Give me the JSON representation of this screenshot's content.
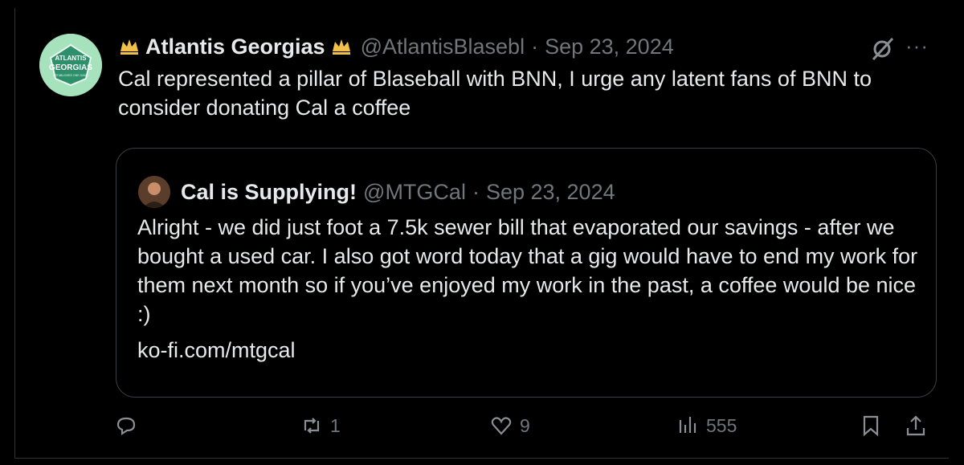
{
  "tweet": {
    "author_name": "Atlantis Georgias",
    "handle": "@AtlantisBlasebl",
    "separator": "·",
    "date": "Sep 23, 2024",
    "body": "Cal represented a pillar of Blaseball with BNN, I urge any latent fans of BNN to consider donating Cal a coffee",
    "more_label": "···",
    "avatar_text": [
      "ATLANTIS",
      "GEORGIAS"
    ],
    "avatar_small_text": "ESTABLISHED ONE GAME"
  },
  "quoted": {
    "author_name": "Cal is Supplying!",
    "handle": "@MTGCal",
    "separator": "·",
    "date": "Sep 23, 2024",
    "body": "Alright - we did just foot a 7.5k sewer bill that evaporated our savings - after we bought a used car. I also got word today that a gig would have to end my work for them next month so if you’ve enjoyed my work in the past, a coffee would be nice :)",
    "link": "ko-fi.com/mtgcal"
  },
  "actions": {
    "replies": "",
    "reposts": "1",
    "likes": "9",
    "views": "555"
  },
  "colors": {
    "background": "#000000",
    "text": "#e7e9ea",
    "muted": "#71767b",
    "crown": "#f0c04a",
    "avatar_bg": "#9fe0b4"
  }
}
